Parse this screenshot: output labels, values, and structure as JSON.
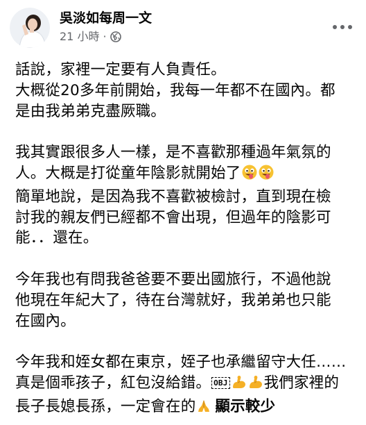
{
  "post": {
    "author": "吳淡如每周一文",
    "time": "21 小時",
    "separator": "·",
    "more_options_icon": "more-horizontal-icon",
    "audience_icon": "globe-icon",
    "body": {
      "p1": {
        "l1": "話說，家裡一定要有人負責任。",
        "l2": "大概從20多年前開始，我每一年都不在國內。都",
        "l3": "是由我弟弟克盡厥職。"
      },
      "p2": {
        "l1": "我其實跟很多人一樣，是不喜歡那種過年氣氛的",
        "l2": "人。大概是打從童年陰影就開始了",
        "l3": "簡單地說，是因為我不喜歡被檢討，直到現在檢",
        "l4": "討我的親友們已經都不會出現，但過年的陰影可",
        "l5": "能．．還在。"
      },
      "p3": {
        "l1": "今年我也有問我爸爸要不要出國旅行，不過他說",
        "l2": "他現在年紀大了，待在台灣就好，我弟弟也只能",
        "l3": "在國內。"
      },
      "p4": {
        "l1": "今年我和姪女都在東京，姪子也承繼留守大任……",
        "l2a": "真是個乖孩子，紅包沒給錯。",
        "obj": "OBJ",
        "l2b": "我們家裡的",
        "l3": "長子長媳長孫，一定會在的"
      },
      "see_more": "顯示較少"
    }
  }
}
